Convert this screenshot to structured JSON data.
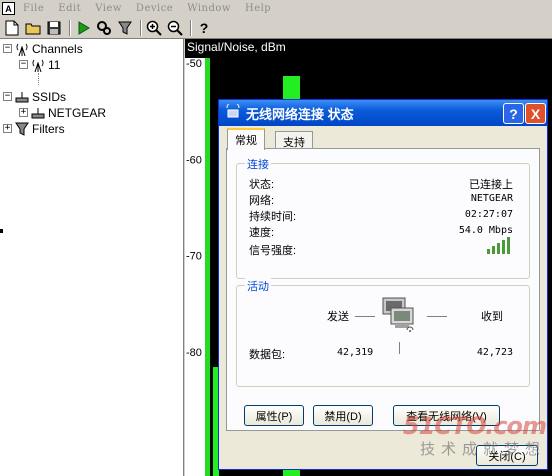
{
  "menubar": {
    "app_icon": "pulse-icon",
    "items": [
      {
        "label": "File"
      },
      {
        "label": "Edit"
      },
      {
        "label": "View"
      },
      {
        "label": "Device"
      },
      {
        "label": "Window"
      },
      {
        "label": "Help"
      }
    ]
  },
  "toolbar": {
    "buttons": [
      "new-file-icon",
      "open-folder-icon",
      "save-icon",
      "play-icon",
      "settings-icon",
      "filter-icon",
      "zoom-in-icon",
      "zoom-out-icon",
      "help-icon"
    ]
  },
  "tree": {
    "channels_label": "Channels",
    "channel_11_label": "11",
    "ssids_label": "SSIDs",
    "netgear_label": "NETGEAR",
    "filters_label": "Filters"
  },
  "chart_data": {
    "type": "bar",
    "title": "Signal/Noise, dBm",
    "y_ticks": [
      "-50",
      "-60",
      "-70",
      "-80"
    ],
    "ylim": [
      -90,
      -50
    ],
    "colors": {
      "background": "#000000",
      "signal": "#22ee22",
      "axis_strip": "#22dd22"
    }
  },
  "dialog": {
    "title": "无线网络连接 状态",
    "help_label": "?",
    "close_label": "X",
    "tabs": [
      {
        "label": "常规"
      },
      {
        "label": "支持"
      }
    ],
    "connection": {
      "group_label": "连接",
      "status_label": "状态:",
      "status_value": "已连接上",
      "network_label": "网络:",
      "network_value": "NETGEAR",
      "duration_label": "持续时间:",
      "duration_value": "02:27:07",
      "speed_label": "速度:",
      "speed_value": "54.0 Mbps",
      "signal_label": "信号强度:"
    },
    "activity": {
      "group_label": "活动",
      "sent_label": "发送",
      "received_label": "收到",
      "packets_label": "数据包:",
      "packets_sent": "42,319",
      "packets_received": "42,723"
    },
    "buttons": {
      "properties": "属性(P)",
      "disable": "禁用(D)",
      "view_networks": "查看无线网络(V)",
      "close": "关闭(C)"
    }
  },
  "watermark": {
    "logo": "51CTO.com",
    "subtitle": "技术成就梦想"
  }
}
